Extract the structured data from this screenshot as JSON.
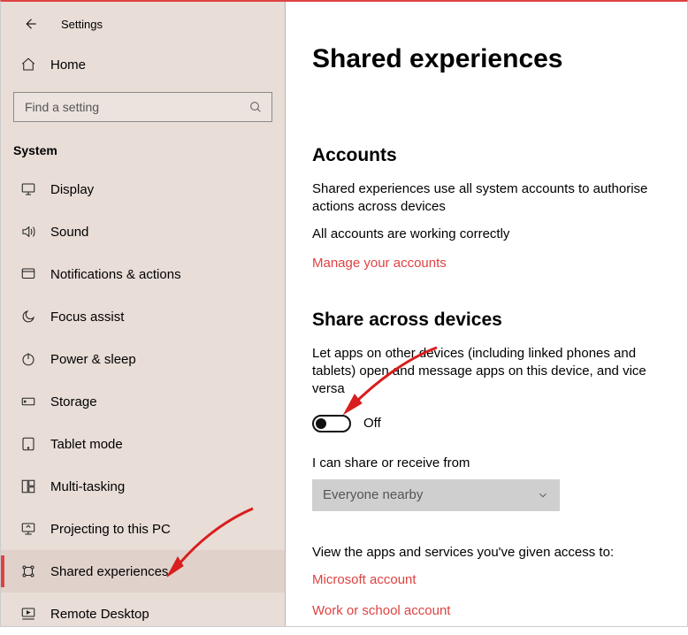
{
  "header": {
    "app_name": "Settings"
  },
  "sidebar": {
    "home_label": "Home",
    "search_placeholder": "Find a setting",
    "section_label": "System",
    "items": [
      {
        "icon": "display",
        "label": "Display"
      },
      {
        "icon": "sound",
        "label": "Sound"
      },
      {
        "icon": "notifications",
        "label": "Notifications & actions"
      },
      {
        "icon": "focus",
        "label": "Focus assist"
      },
      {
        "icon": "power",
        "label": "Power & sleep"
      },
      {
        "icon": "storage",
        "label": "Storage"
      },
      {
        "icon": "tablet",
        "label": "Tablet mode"
      },
      {
        "icon": "multitask",
        "label": "Multi-tasking"
      },
      {
        "icon": "projecting",
        "label": "Projecting to this PC"
      },
      {
        "icon": "shared",
        "label": "Shared experiences",
        "active": true
      },
      {
        "icon": "remote",
        "label": "Remote Desktop"
      }
    ]
  },
  "page": {
    "title": "Shared experiences",
    "accounts": {
      "heading": "Accounts",
      "description": "Shared experiences use all system accounts to authorise actions across devices",
      "status": "All accounts are working correctly",
      "manage_link": "Manage your accounts"
    },
    "share": {
      "heading": "Share across devices",
      "description": "Let apps on other devices (including linked phones and tablets) open and message apps on this device, and vice versa",
      "toggle_state": "Off",
      "receive_label": "I can share or receive from",
      "dropdown_value": "Everyone nearby",
      "access_label": "View the apps and services you've given access to:",
      "link_ms": "Microsoft account",
      "link_work": "Work or school account"
    }
  }
}
